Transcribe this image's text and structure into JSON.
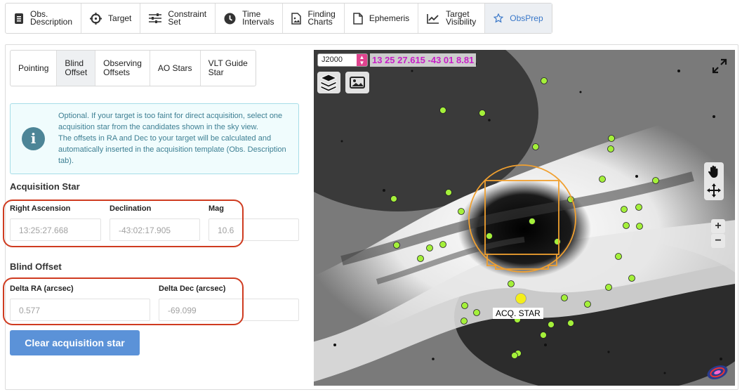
{
  "top_tabs": [
    {
      "label": "Obs.\nDescription",
      "icon": "document-icon"
    },
    {
      "label": "Target",
      "icon": "crosshair-icon"
    },
    {
      "label": "Constraint\nSet",
      "icon": "sliders-icon"
    },
    {
      "label": "Time\nIntervals",
      "icon": "clock-icon"
    },
    {
      "label": "Finding\nCharts",
      "icon": "image-file-icon"
    },
    {
      "label": "Ephemeris",
      "icon": "file-icon"
    },
    {
      "label": "Target\nVisibility",
      "icon": "chart-line-icon"
    },
    {
      "label": "ObsPrep",
      "icon": "star-icon"
    }
  ],
  "sub_tabs": [
    "Pointing",
    "Blind\nOffset",
    "Observing\nOffsets",
    "AO Stars",
    "VLT Guide\nStar"
  ],
  "info": {
    "icon": "info-icon",
    "text": "Optional. If your target is too faint for direct acquisition, select one acquisition star from the candidates shown in the sky view.\nThe offsets in RA and Dec to your target will be calculated and automatically inserted in the acquisition template (Obs. Description tab)."
  },
  "acquisition_star": {
    "title": "Acquisition Star",
    "ra_label": "Right Ascension",
    "ra_value": "13:25:27.668",
    "dec_label": "Declination",
    "dec_value": "-43:02:17.905",
    "mag_label": "Mag",
    "mag_value": "10.6"
  },
  "blind_offset": {
    "title": "Blind Offset",
    "dra_label": "Delta RA (arcsec)",
    "dra_value": "0.577",
    "ddec_label": "Delta Dec (arcsec)",
    "ddec_value": "-69.099"
  },
  "clear_button": "Clear acquisition star",
  "sky": {
    "frame": "J2000",
    "coordinates": "13 25 27.615 -43 01 8.81",
    "acq_label": "ACQ. STAR",
    "zoom_in": "+",
    "zoom_out": "−"
  },
  "colors": {
    "accent": "#3a78c9",
    "highlight_ring": "#cf3b20",
    "candidate": "#a4f03a",
    "acq_star": "#f4ee1a",
    "footprint": "#f0a030",
    "coords_text": "#c81ec8"
  }
}
